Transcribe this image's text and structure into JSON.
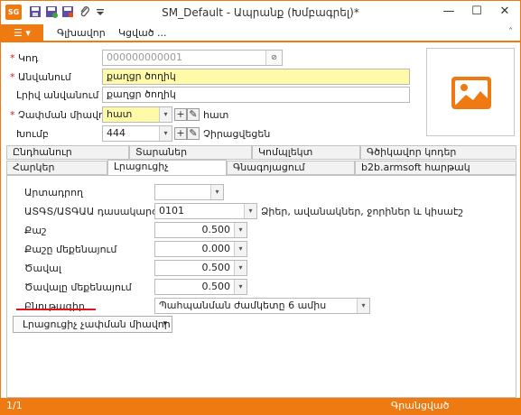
{
  "window": {
    "title": "SM_Default - Ապրանք (Խմբագրել)*",
    "app_logo": "SG",
    "minimize_icon": "—",
    "maximize_icon": "☐",
    "close_icon": "✕"
  },
  "ribbon": {
    "file_icon": "☰",
    "file_caret": "▾",
    "tabs": [
      "Գլխավոր",
      "Կցված ..."
    ],
    "collapse_icon": "˄"
  },
  "form": {
    "code": {
      "required": "*",
      "label": "Կոդ",
      "value": "000000000001"
    },
    "name": {
      "required": "*",
      "label": "Անվանում",
      "value": "քաղցր ծողիկ"
    },
    "full_name": {
      "label": "Լրիվ անվանում",
      "value": "քաղցր ծողիկ"
    },
    "unit": {
      "required": "*",
      "label": "Չափման միավոր",
      "value": "հատ",
      "caption": "հատ"
    },
    "group": {
      "label": "Խումբ",
      "value": "444",
      "caption": "Չիրացվեցեն"
    }
  },
  "tabs_row1": [
    "Ընդհանուր",
    "Տարաներ",
    "Կոմպլեկտ",
    "Գծիկավոր կոդեր"
  ],
  "tabs_row2": [
    "Հարկեր",
    "Լրացուցիչ",
    "Գնագոյացում",
    "b2b.armsoft hարթակ"
  ],
  "details": {
    "producer": {
      "label": "Արտադրող",
      "value": ""
    },
    "atgaa": {
      "label": "ԱՏԳՏ/ԱՏԳԱԱ դասակարգիչ",
      "value": "0101",
      "caption": "Ձիեր, ավանակներ, ջորիներ և կիսաէշ"
    },
    "weight": {
      "label": "Քաշ",
      "value": "0.500"
    },
    "weight_unit": {
      "label": "Քաշը մեքենայում",
      "value": "0.000"
    },
    "volume": {
      "label": "Ծավալ",
      "value": "0.500"
    },
    "volume_unit": {
      "label": "Ծավալը մեքենայում",
      "value": "0.500"
    },
    "description": {
      "label": "Բնութագիր",
      "value": "Պահպանման ժամկետը 6 ամիս"
    }
  },
  "extra_units_button": "Լրացուցիչ չափման միավոր",
  "status": {
    "left": "1/1",
    "right": "Գրանցված"
  },
  "icons": {
    "dropdown": "▾",
    "plus": "+",
    "edit": "✎",
    "picker": "⊘"
  },
  "colors": {
    "accent": "#f07a12",
    "required": "#d21d1d",
    "highlight_field": "#fffaa7",
    "underline": "#e0141a"
  }
}
